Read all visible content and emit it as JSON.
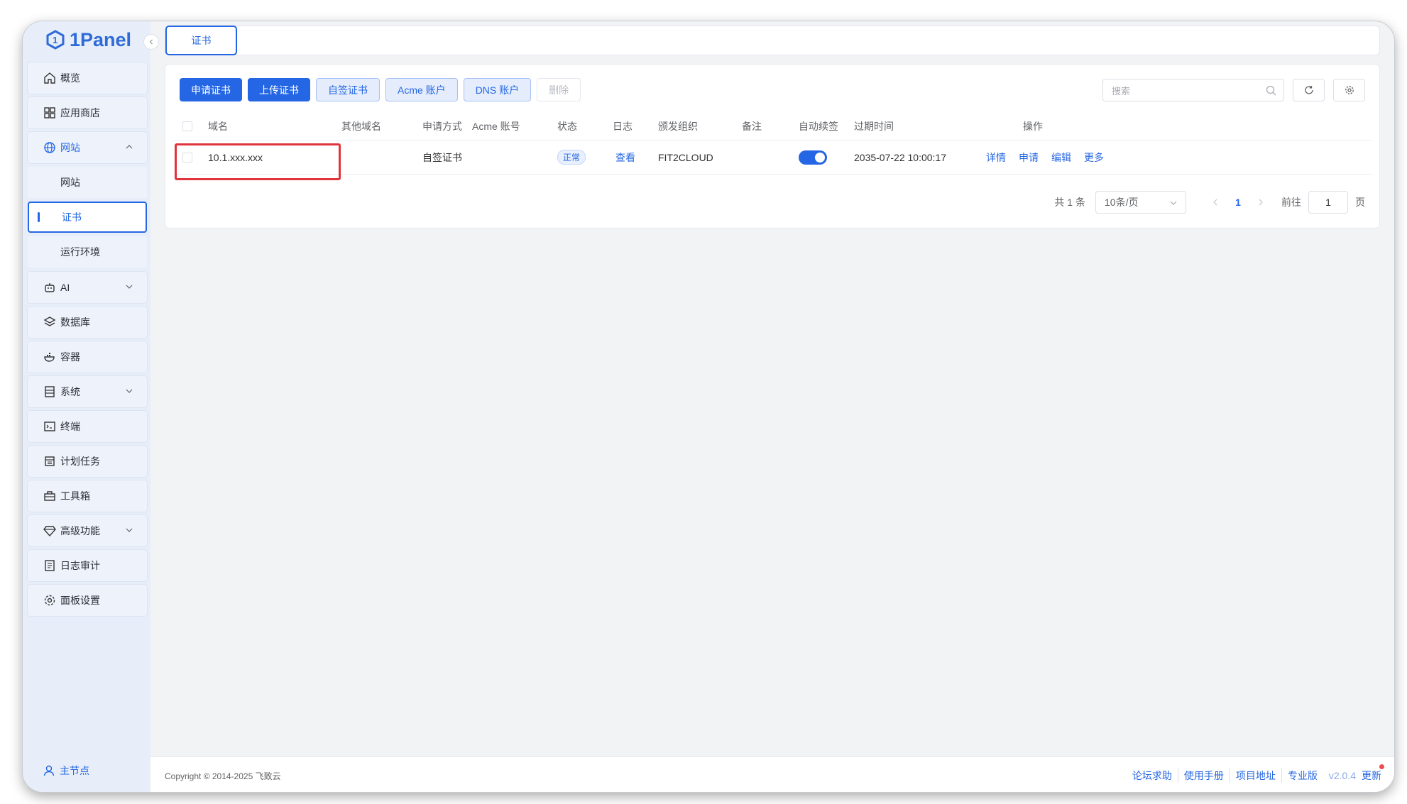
{
  "brand": {
    "name": "1Panel"
  },
  "sidebar": {
    "items": [
      {
        "label": "概览",
        "icon": "home-icon"
      },
      {
        "label": "应用商店",
        "icon": "apps-icon"
      },
      {
        "label": "网站",
        "icon": "globe-icon",
        "open": true
      },
      {
        "label": "网站",
        "sub": true
      },
      {
        "label": "证书",
        "sub": true,
        "active": true
      },
      {
        "label": "运行环境",
        "sub": true
      },
      {
        "label": "AI",
        "icon": "robot-icon",
        "expandable": true
      },
      {
        "label": "数据库",
        "icon": "layers-icon"
      },
      {
        "label": "容器",
        "icon": "docker-icon"
      },
      {
        "label": "系统",
        "icon": "server-icon",
        "expandable": true
      },
      {
        "label": "终端",
        "icon": "terminal-icon"
      },
      {
        "label": "计划任务",
        "icon": "calendar-icon"
      },
      {
        "label": "工具箱",
        "icon": "toolbox-icon"
      },
      {
        "label": "高级功能",
        "icon": "diamond-icon",
        "expandable": true
      },
      {
        "label": "日志审计",
        "icon": "log-icon"
      },
      {
        "label": "面板设置",
        "icon": "gear-icon"
      }
    ],
    "footer_label": "主节点"
  },
  "tabs": [
    {
      "label": "证书"
    }
  ],
  "toolbar": {
    "apply_cert": "申请证书",
    "upload_cert": "上传证书",
    "self_signed": "自签证书",
    "acme_account": "Acme 账户",
    "dns_account": "DNS 账户",
    "delete": "删除"
  },
  "search": {
    "placeholder": "搜索"
  },
  "table": {
    "headers": [
      "域名",
      "其他域名",
      "申请方式",
      "Acme 账号",
      "状态",
      "日志",
      "颁发组织",
      "备注",
      "自动续签",
      "过期时间",
      "操作"
    ],
    "rows": [
      {
        "domain": "10.1.xxx.xxx",
        "other_domains": "",
        "method": "自签证书",
        "acme": "",
        "status": "正常",
        "log": "查看",
        "issuer": "FIT2CLOUD",
        "remark": "",
        "auto_renew": true,
        "expire": "2035-07-22 10:00:17",
        "actions": [
          "详情",
          "申请",
          "编辑",
          "更多"
        ]
      }
    ]
  },
  "pagination": {
    "total": "共 1 条",
    "page_size": "10条/页",
    "current": "1",
    "goto_label": "前往",
    "goto_value": "1",
    "page_unit": "页"
  },
  "footer": {
    "copyright": "Copyright © 2014-2025 飞致云",
    "links": [
      "论坛求助",
      "使用手册",
      "项目地址",
      "专业版"
    ],
    "version": "v2.0.4",
    "update": "更新"
  },
  "colors": {
    "accent": "#2466e3",
    "highlight": "#e0343a"
  }
}
